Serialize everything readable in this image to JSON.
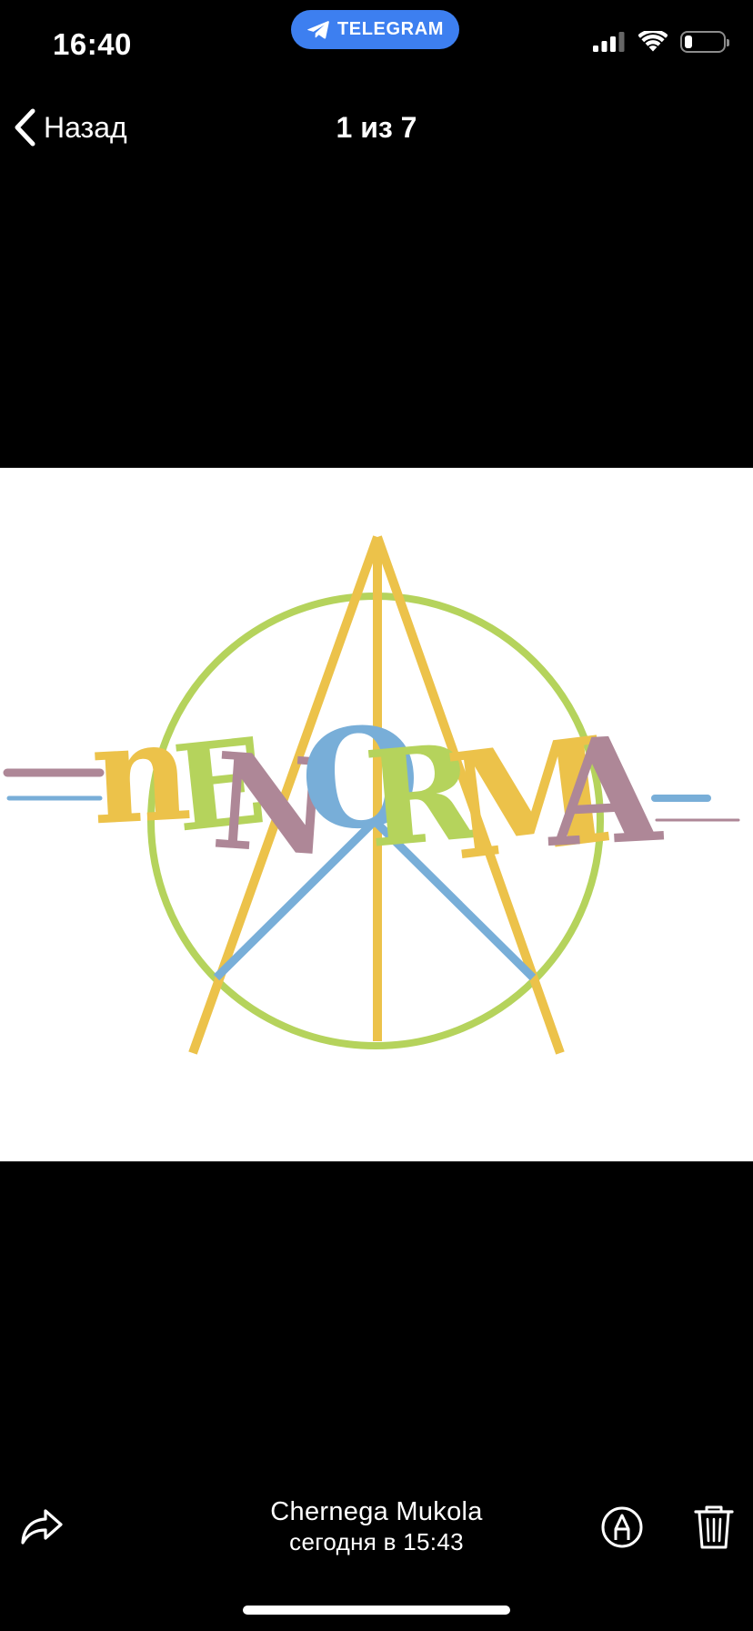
{
  "status_bar": {
    "time": "16:40",
    "return_app": "TELEGRAM",
    "battery_level": 0.2,
    "icons": [
      "cellular-signal-icon",
      "wifi-icon",
      "battery-icon"
    ]
  },
  "nav": {
    "back_label": "Назад",
    "counter": "1 из 7"
  },
  "photo": {
    "background": "#ffffff"
  },
  "footer": {
    "sender": "Chernega Mukola",
    "date": "сегодня в 15:43",
    "icons": [
      "share-icon",
      "markup-icon",
      "trash-icon"
    ]
  },
  "colors": {
    "background": "#000000",
    "pill": "#3d7ff0",
    "logo_yellow": "#ecc24a",
    "logo_green": "#b5d35c",
    "logo_blue": "#78aed8",
    "logo_mauve": "#ae8797"
  }
}
